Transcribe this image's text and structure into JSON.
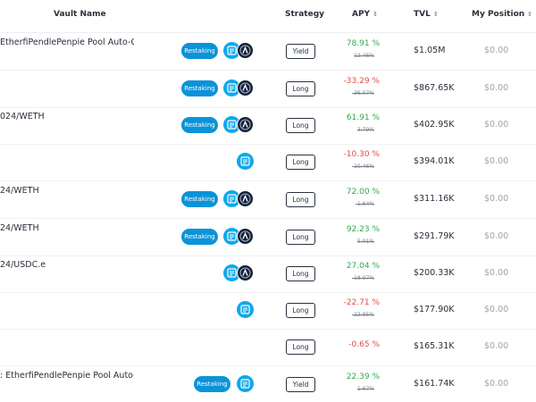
{
  "header": {
    "vault_name": "Vault Name",
    "strategy": "Strategy",
    "apy": "APY",
    "tvl": "TVL",
    "my_position": "My Position",
    "sort_icon": "⇕"
  },
  "rows": [
    {
      "vault": "EtherfiPendlePenpie Pool Auto-Co",
      "restaking": "Restaking",
      "strategy": "Yield",
      "apy": "78.91 %",
      "apy_sub": "12.46%",
      "tvl": "$1.05M",
      "position": "$0.00"
    },
    {
      "vault": "",
      "restaking": "Restaking",
      "strategy": "Long",
      "apy": "-33.29 %",
      "apy_sub": "-36.07%",
      "tvl": "$867.65K",
      "position": "$0.00"
    },
    {
      "vault": "024/WETH",
      "restaking": "Restaking",
      "strategy": "Long",
      "apy": "61.91 %",
      "apy_sub": "3.79%",
      "tvl": "$402.95K",
      "position": "$0.00"
    },
    {
      "vault": "",
      "restaking": "",
      "strategy": "Long",
      "apy": "-10.30 %",
      "apy_sub": "-10.46%",
      "tvl": "$394.01K",
      "position": "$0.00"
    },
    {
      "vault": "24/WETH",
      "restaking": "Restaking",
      "strategy": "Long",
      "apy": "72.00 %",
      "apy_sub": "-1.64%",
      "tvl": "$311.16K",
      "position": "$0.00"
    },
    {
      "vault": "24/WETH",
      "restaking": "Restaking",
      "strategy": "Long",
      "apy": "92.23 %",
      "apy_sub": "5.01%",
      "tvl": "$291.79K",
      "position": "$0.00"
    },
    {
      "vault": "24/USDC.e",
      "restaking": "",
      "strategy": "Long",
      "apy": "27.04 %",
      "apy_sub": "-18.97%",
      "tvl": "$200.33K",
      "position": "$0.00"
    },
    {
      "vault": "",
      "restaking": "",
      "strategy": "Long",
      "apy": "-22.71 %",
      "apy_sub": "-22.85%",
      "tvl": "$177.90K",
      "position": "$0.00"
    },
    {
      "vault": "",
      "restaking": "",
      "strategy": "Long",
      "apy": "-0.65 %",
      "apy_sub": "",
      "tvl": "$165.31K",
      "position": "$0.00"
    },
    {
      "vault": ": EtherfiPendlePenpie Pool Auto-C",
      "restaking": "Restaking",
      "strategy": "Yield",
      "apy": "22.39 %",
      "apy_sub": "1.67%",
      "tvl": "$161.74K",
      "position": "$0.00"
    }
  ],
  "colors": {
    "accent": "#0b93d8",
    "positive": "#31a94f",
    "negative": "#e24b4b"
  }
}
